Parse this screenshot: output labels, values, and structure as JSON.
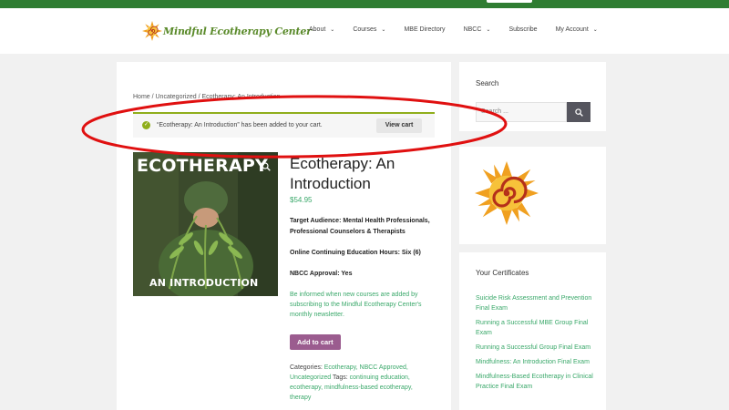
{
  "header": {
    "logo_text": "Mindful Ecotherapy Center",
    "nav": [
      {
        "label": "About",
        "has_dropdown": true
      },
      {
        "label": "Courses",
        "has_dropdown": true
      },
      {
        "label": "MBE Directory",
        "has_dropdown": false
      },
      {
        "label": "NBCC",
        "has_dropdown": true
      },
      {
        "label": "Subscribe",
        "has_dropdown": false
      },
      {
        "label": "My Account",
        "has_dropdown": true
      }
    ],
    "chevron": "⌄"
  },
  "breadcrumb": "Home / Uncategorized / Ecotherapy: An Introduction",
  "notice": {
    "message": "“Ecotherapy: An Introduction” has been added to your cart.",
    "button": "View cart",
    "icon": "check-circle-icon"
  },
  "product": {
    "image_title": "ECOTHERAPY",
    "image_subtitle": "AN INTRODUCTION",
    "title": "Ecotherapy: An Introduction",
    "price": "$54.95",
    "target_audience": "Target Audience: Mental Health Professionals, Professional Counselors & Therapists",
    "ce_hours": "Online Continuing Education Hours: Six (6)",
    "nbcc": "NBCC Approval: Yes",
    "newsletter": "Be informed when new courses are added by subscribing to the Mindful Ecotherapy Center's monthly newsletter.",
    "add_to_cart": "Add to cart",
    "categories_label": "Categories:",
    "categories": "Ecotherapy, NBCC Approved, Uncategorized",
    "tags_label": "Tags:",
    "tags": "continuing education, ecotherapy, mindfulness-based ecotherapy, therapy"
  },
  "sidebar": {
    "search_title": "Search",
    "search_placeholder": "Search ...",
    "certs_title": "Your Certificates",
    "certificates": [
      "Suicide Risk Assessment and Prevention Final Exam",
      "Running a Successful MBE Group Final Exam",
      "Running a Successful Group Final Exam",
      "Mindfulness: An Introduction Final Exam",
      "Mindfulness-Based Ecotherapy in Clinical Practice Final Exam"
    ]
  },
  "colors": {
    "topbar": "#2f7d32",
    "link_green": "#3aa86a",
    "add_to_cart": "#9b5c8f",
    "annotation_red": "#e01010"
  }
}
